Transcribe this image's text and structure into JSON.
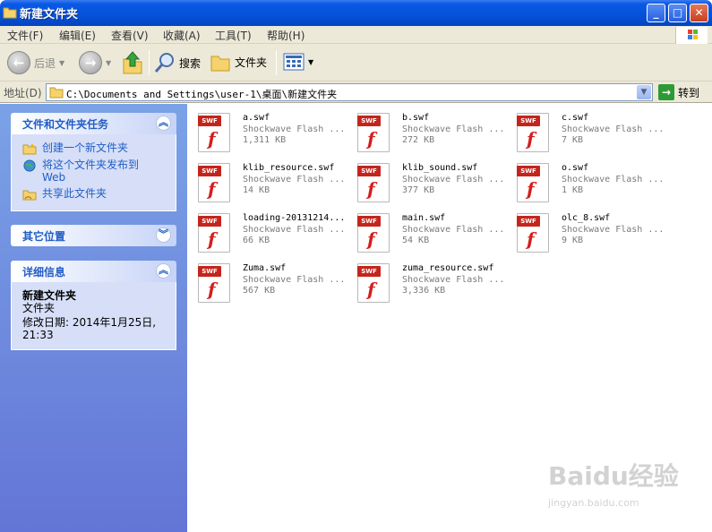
{
  "window": {
    "title": "新建文件夹"
  },
  "menu": [
    "文件(F)",
    "编辑(E)",
    "查看(V)",
    "收藏(A)",
    "工具(T)",
    "帮助(H)"
  ],
  "toolbar": {
    "back_label": "后退",
    "search_label": "搜索",
    "folders_label": "文件夹"
  },
  "address": {
    "label": "地址(D)",
    "path": "C:\\Documents and Settings\\user-1\\桌面\\新建文件夹",
    "go_label": "转到"
  },
  "tasks_panel": {
    "title": "文件和文件夹任务",
    "items": [
      "创建一个新文件夹",
      "将这个文件夹发布到 Web",
      "共享此文件夹"
    ]
  },
  "other_panel": {
    "title": "其它位置"
  },
  "details_panel": {
    "title": "详细信息",
    "name": "新建文件夹",
    "type": "文件夹",
    "modified": "修改日期: 2014年1月25日, 21:33"
  },
  "files": [
    {
      "name": "a.swf",
      "type": "Shockwave Flash ...",
      "size": "1,311 KB"
    },
    {
      "name": "b.swf",
      "type": "Shockwave Flash ...",
      "size": "272 KB"
    },
    {
      "name": "c.swf",
      "type": "Shockwave Flash ...",
      "size": "7 KB"
    },
    {
      "name": "klib_resource.swf",
      "type": "Shockwave Flash ...",
      "size": "14 KB"
    },
    {
      "name": "klib_sound.swf",
      "type": "Shockwave Flash ...",
      "size": "377 KB"
    },
    {
      "name": "o.swf",
      "type": "Shockwave Flash ...",
      "size": "1 KB"
    },
    {
      "name": "loading-20131214...",
      "type": "Shockwave Flash ...",
      "size": "66 KB"
    },
    {
      "name": "main.swf",
      "type": "Shockwave Flash ...",
      "size": "54 KB"
    },
    {
      "name": "olc_8.swf",
      "type": "Shockwave Flash ...",
      "size": "9 KB"
    },
    {
      "name": "Zuma.swf",
      "type": "Shockwave Flash ...",
      "size": "567 KB"
    },
    {
      "name": "zuma_resource.swf",
      "type": "Shockwave Flash ...",
      "size": "3,336 KB"
    }
  ],
  "file_badge": "SWF",
  "watermark": {
    "brand": "Baidu经验",
    "url": "jingyan.baidu.com"
  }
}
